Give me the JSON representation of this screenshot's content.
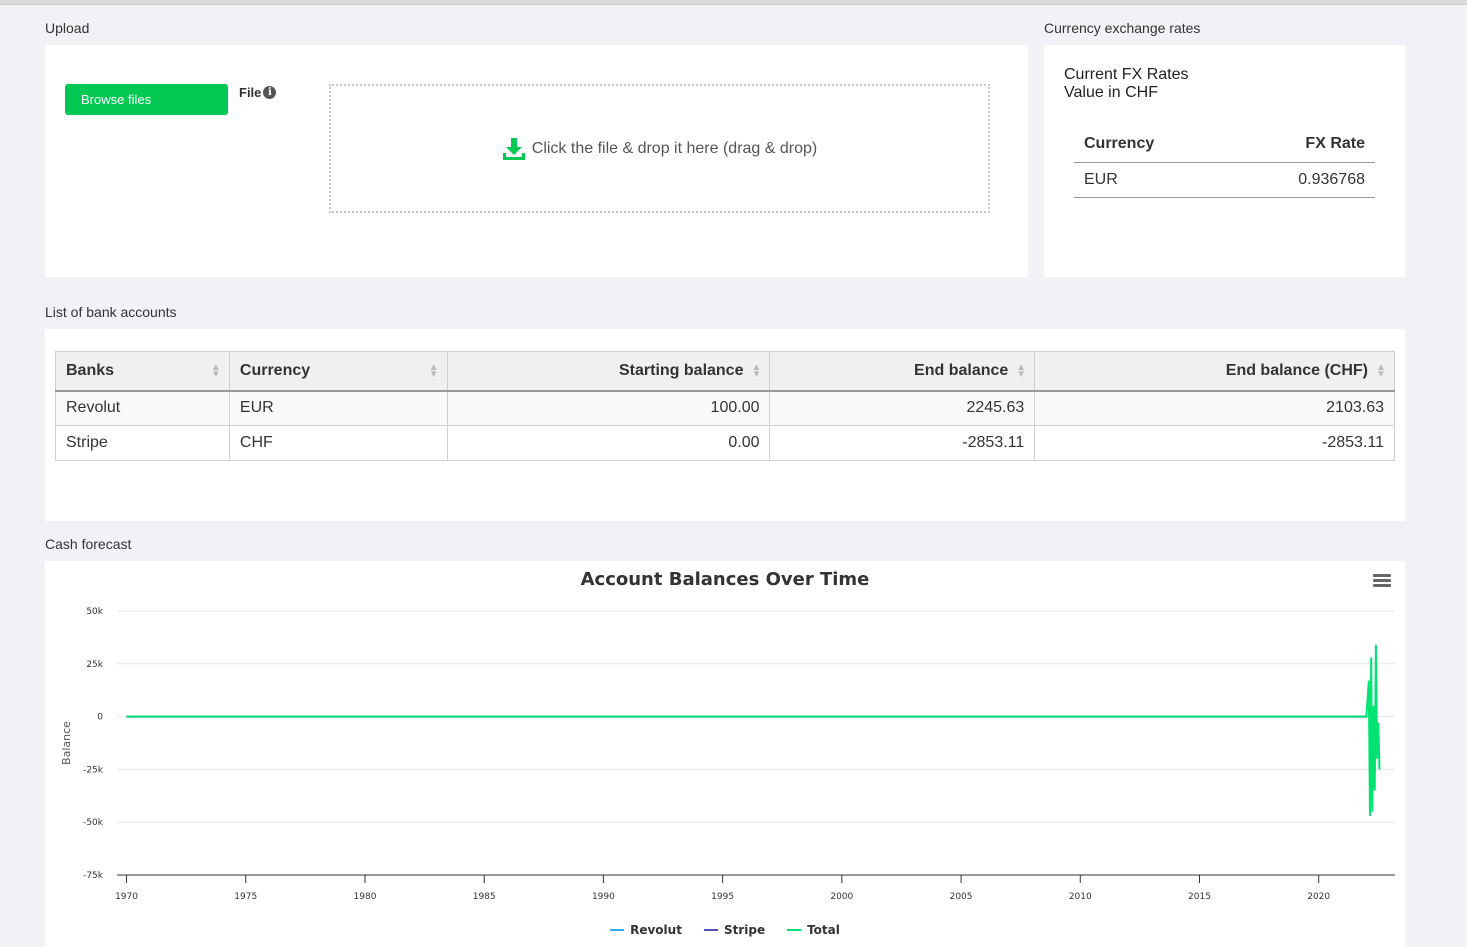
{
  "sections": {
    "upload": "Upload",
    "fx": "Currency exchange rates",
    "accounts": "List of bank accounts",
    "forecast": "Cash forecast"
  },
  "upload": {
    "browse_label": "Browse files",
    "file_label": "File",
    "dropzone_text": "Click the file & drop it here (drag & drop)"
  },
  "fx": {
    "title_line1": "Current FX Rates",
    "title_line2": "Value in CHF",
    "headers": [
      "Currency",
      "FX Rate"
    ],
    "rows": [
      [
        "EUR",
        "0.936768"
      ]
    ]
  },
  "accounts": {
    "headers": [
      "Banks",
      "Currency",
      "Starting balance",
      "End balance",
      "End balance (CHF)"
    ],
    "rows": [
      [
        "Revolut",
        "EUR",
        "100.00",
        "2245.63",
        "2103.63"
      ],
      [
        "Stripe",
        "CHF",
        "0.00",
        "-2853.11",
        "-2853.11"
      ]
    ]
  },
  "chart_data": {
    "type": "line",
    "title": "Account Balances Over Time",
    "xlabel": "",
    "ylabel": "Balance",
    "x_ticks": [
      "1970",
      "1975",
      "1980",
      "1985",
      "1990",
      "1995",
      "2000",
      "2005",
      "2010",
      "2015",
      "2020"
    ],
    "y_ticks": [
      "50k",
      "25k",
      "0",
      "-25k",
      "-50k",
      "-75k"
    ],
    "xlim": [
      1969.6,
      2023.2
    ],
    "ylim": [
      -75000,
      50000
    ],
    "legend_position": "bottom",
    "series": [
      {
        "name": "Revolut",
        "color": "#2caffe",
        "points": [
          [
            1970,
            0
          ],
          [
            2022.0,
            0
          ]
        ]
      },
      {
        "name": "Stripe",
        "color": "#544fc5",
        "points": [
          [
            1970,
            0
          ],
          [
            2022.0,
            0
          ]
        ]
      },
      {
        "name": "Total",
        "color": "#00e272",
        "points": [
          [
            1970,
            0
          ],
          [
            2022.0,
            0
          ],
          [
            2022.1,
            17000
          ],
          [
            2022.15,
            -47000
          ],
          [
            2022.2,
            28000
          ],
          [
            2022.25,
            -45000
          ],
          [
            2022.3,
            5000
          ],
          [
            2022.35,
            -35000
          ],
          [
            2022.4,
            34000
          ],
          [
            2022.45,
            -20000
          ],
          [
            2022.5,
            -3000
          ],
          [
            2022.55,
            -25000
          ]
        ]
      }
    ]
  }
}
